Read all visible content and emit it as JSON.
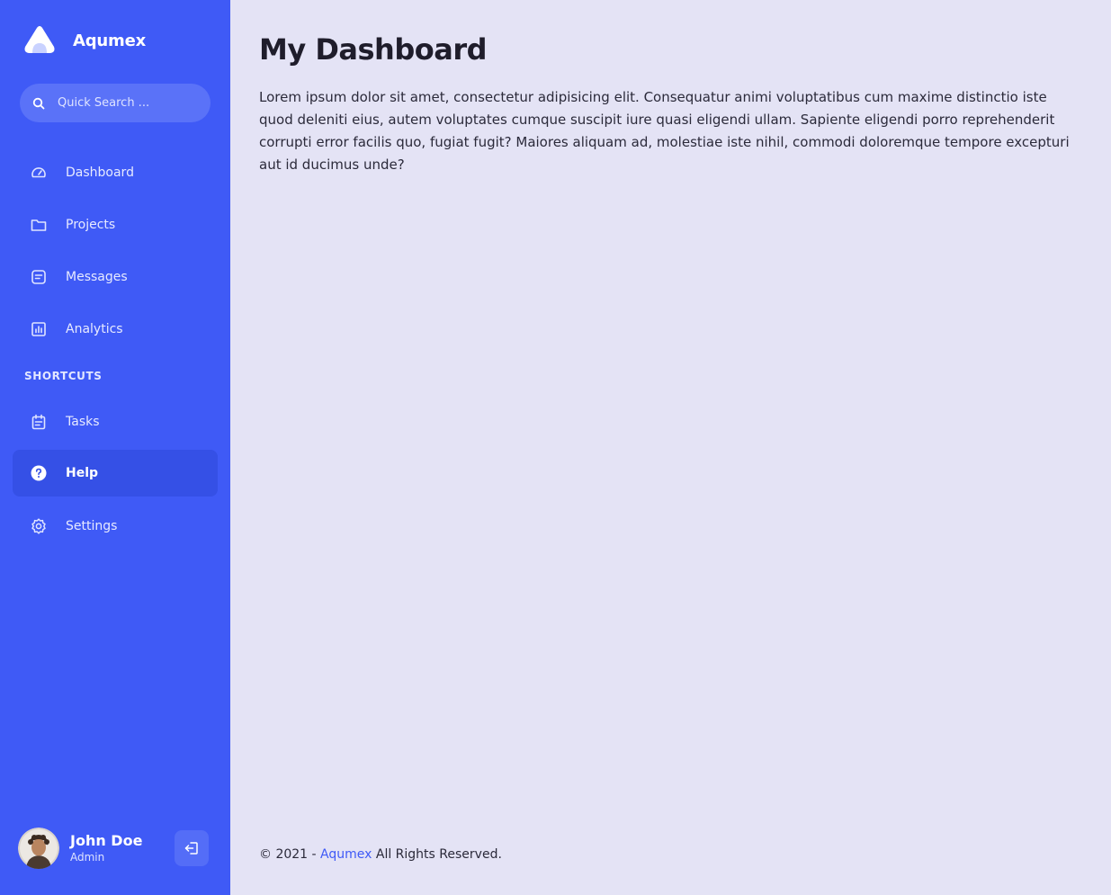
{
  "brand": {
    "name": "Aqumex"
  },
  "search": {
    "placeholder": "Quick Search ..."
  },
  "sidebar": {
    "items": [
      {
        "label": "Dashboard",
        "icon": "speedometer-icon"
      },
      {
        "label": "Projects",
        "icon": "folder-icon"
      },
      {
        "label": "Messages",
        "icon": "message-icon"
      },
      {
        "label": "Analytics",
        "icon": "bar-chart-icon"
      }
    ],
    "section_title": "SHORTCUTS",
    "shortcuts": [
      {
        "label": "Tasks",
        "icon": "calendar-icon"
      },
      {
        "label": "Help",
        "icon": "question-circle-icon",
        "active": true
      },
      {
        "label": "Settings",
        "icon": "gear-icon"
      }
    ]
  },
  "profile": {
    "name": "John Doe",
    "role": "Admin"
  },
  "main": {
    "title": "My Dashboard",
    "intro": "Lorem ipsum dolor sit amet, consectetur adipisicing elit. Consequatur animi voluptatibus cum maxime distinctio iste quod deleniti eius, autem voluptates cumque suscipit iure quasi eligendi ullam. Sapiente eligendi porro reprehenderit corrupti error facilis quo, fugiat fugit? Maiores aliquam ad, molestiae iste nihil, commodi doloremque tempore excepturi aut id ducimus unde?"
  },
  "footer": {
    "prefix": "© 2021 - ",
    "link": "Aqumex",
    "suffix": " All Rights Reserved."
  },
  "colors": {
    "sidebar": "#3f5af6",
    "sidebar_active": "#3550e6",
    "page_background": "#e4e3f5",
    "accent": "#3f5af6"
  }
}
